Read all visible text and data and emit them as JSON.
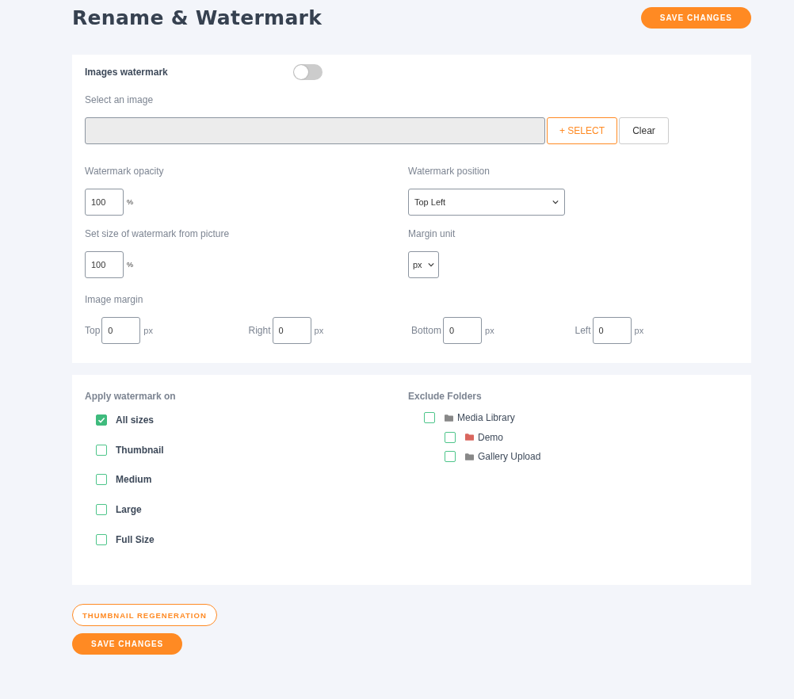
{
  "title": "Rename & Watermark",
  "header_button": "SAVE CHANGES",
  "watermark": {
    "label": "Images watermark",
    "on": false
  },
  "image_select": {
    "label": "Select an image",
    "select_button": "+ SELECT",
    "clear_button": "Clear"
  },
  "opacity": {
    "label": "Watermark opacity",
    "value": "100",
    "unit": "%"
  },
  "position": {
    "label": "Watermark position",
    "value": "Top Left"
  },
  "size": {
    "label": "Set size of watermark from picture",
    "value": "100",
    "unit": "%"
  },
  "margin_unit": {
    "label": "Margin unit",
    "value": "px"
  },
  "image_margin": {
    "label": "Image margin",
    "fields": [
      {
        "label": "Top",
        "value": "0",
        "unit": "px"
      },
      {
        "label": "Right",
        "value": "0",
        "unit": "px"
      },
      {
        "label": "Bottom",
        "value": "0",
        "unit": "px"
      },
      {
        "label": "Left",
        "value": "0",
        "unit": "px"
      }
    ]
  },
  "apply_on": {
    "title": "Apply watermark on",
    "options": [
      {
        "label": "All sizes",
        "checked": true
      },
      {
        "label": "Thumbnail",
        "checked": false
      },
      {
        "label": "Medium",
        "checked": false
      },
      {
        "label": "Large",
        "checked": false
      },
      {
        "label": "Full Size",
        "checked": false
      }
    ]
  },
  "exclude_folders": {
    "title": "Exclude Folders",
    "tree": [
      {
        "label": "Media Library",
        "checked": false,
        "color": "#888888",
        "children": [
          {
            "label": "Demo",
            "checked": false,
            "color": "#d9665e"
          },
          {
            "label": "Gallery Upload",
            "checked": false,
            "color": "#888888"
          }
        ]
      }
    ]
  },
  "footer_buttons": [
    {
      "label": "THUMBNAIL REGENERATION",
      "kind": "outline"
    },
    {
      "label": "SAVE CHANGES",
      "kind": "filled"
    }
  ]
}
